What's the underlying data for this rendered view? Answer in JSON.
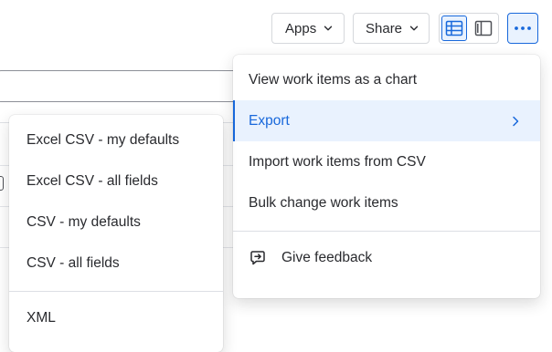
{
  "toolbar": {
    "apps_label": "Apps",
    "share_label": "Share"
  },
  "more_menu": {
    "items": [
      {
        "label": "View work items as a chart"
      },
      {
        "label": "Export",
        "selected": true
      },
      {
        "label": "Import work items from CSV"
      },
      {
        "label": "Bulk change work items"
      }
    ],
    "feedback_label": "Give feedback"
  },
  "export_menu": {
    "items": [
      {
        "label": "Excel CSV - my defaults"
      },
      {
        "label": "Excel CSV - all fields"
      },
      {
        "label": "CSV - my defaults"
      },
      {
        "label": "CSV - all fields"
      }
    ],
    "xml_label": "XML"
  },
  "colors": {
    "accent": "#1868db",
    "accent_bg": "#e9f2fe",
    "text": "#292a2e",
    "border": "#d6d8dc"
  },
  "icons": {
    "apps_chevron": "chevron-down-icon",
    "share_chevron": "chevron-down-icon",
    "view_list": "list-view-icon",
    "view_detail": "detail-view-icon",
    "more": "more-horizontal-icon",
    "export_arrow": "chevron-right-icon",
    "feedback": "feedback-icon"
  }
}
